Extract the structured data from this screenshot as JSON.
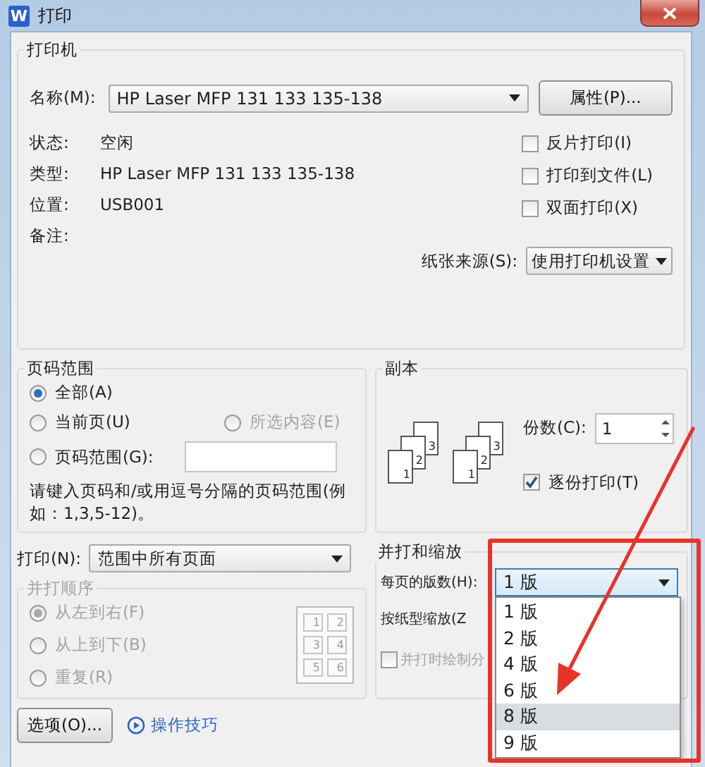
{
  "window": {
    "title": "打印",
    "icon_text": "W"
  },
  "printer": {
    "title": "打印机",
    "name_label": "名称(M):",
    "name_value": "HP Laser MFP 131 133 135-138",
    "properties_button": "属性(P)...",
    "info": [
      {
        "label": "状态:",
        "value": "空闲"
      },
      {
        "label": "类型:",
        "value": "HP Laser MFP 131 133 135-138"
      },
      {
        "label": "位置:",
        "value": "USB001"
      },
      {
        "label": "备注:"
      }
    ],
    "options": [
      {
        "label": "反片打印(I)",
        "checked": false
      },
      {
        "label": "打印到文件(L)",
        "checked": false
      },
      {
        "label": "双面打印(X)",
        "checked": false
      }
    ],
    "paper_source_label": "纸张来源(S):",
    "paper_source_value": "使用打印机设置"
  },
  "page_range": {
    "title": "页码范围",
    "options": [
      {
        "label": "全部(A)",
        "selected": true,
        "disabled": false
      },
      {
        "label": "当前页(U)",
        "selected": false,
        "disabled": false
      },
      {
        "label": "所选内容(E)",
        "selected": false,
        "disabled": true
      },
      {
        "label": "页码范围(G):",
        "selected": false,
        "disabled": false
      }
    ],
    "hint": "请键入页码和/或用逗号分隔的页码范围(例如：1,3,5-12)。"
  },
  "copies": {
    "title": "副本",
    "stacks": [
      [
        "1",
        "2",
        "3"
      ],
      [
        "1",
        "2",
        "3"
      ]
    ],
    "count_label": "份数(C):",
    "count_value": "1",
    "collate_label": "逐份打印(T)",
    "collate_checked": true
  },
  "print_what": {
    "label": "打印(N):",
    "value": "范围中所有页面"
  },
  "order": {
    "title": "并打顺序",
    "disabled": true,
    "options": [
      {
        "label": "从左到右(F)",
        "selected": true
      },
      {
        "label": "从上到下(B)",
        "selected": false
      },
      {
        "label": "重复(R)",
        "selected": false
      }
    ],
    "preview": [
      "1",
      "2",
      "3",
      "4",
      "5",
      "6"
    ]
  },
  "zoom": {
    "title": "并打和缩放",
    "pages_label": "每页的版数(H):",
    "pages_value": "1 版",
    "scale_label": "按纸型缩放(Z",
    "border_label": "并打时绘制分",
    "border_checked": false,
    "border_disabled": true,
    "menu": [
      {
        "label": "1 版",
        "highlighted": false
      },
      {
        "label": "2 版",
        "highlighted": false
      },
      {
        "label": "4 版",
        "highlighted": false
      },
      {
        "label": "6 版",
        "highlighted": false
      },
      {
        "label": "8 版",
        "highlighted": true
      },
      {
        "label": "9 版",
        "highlighted": false
      }
    ]
  },
  "footer": {
    "options_button": "选项(O)...",
    "tips_link": "操作技巧"
  }
}
